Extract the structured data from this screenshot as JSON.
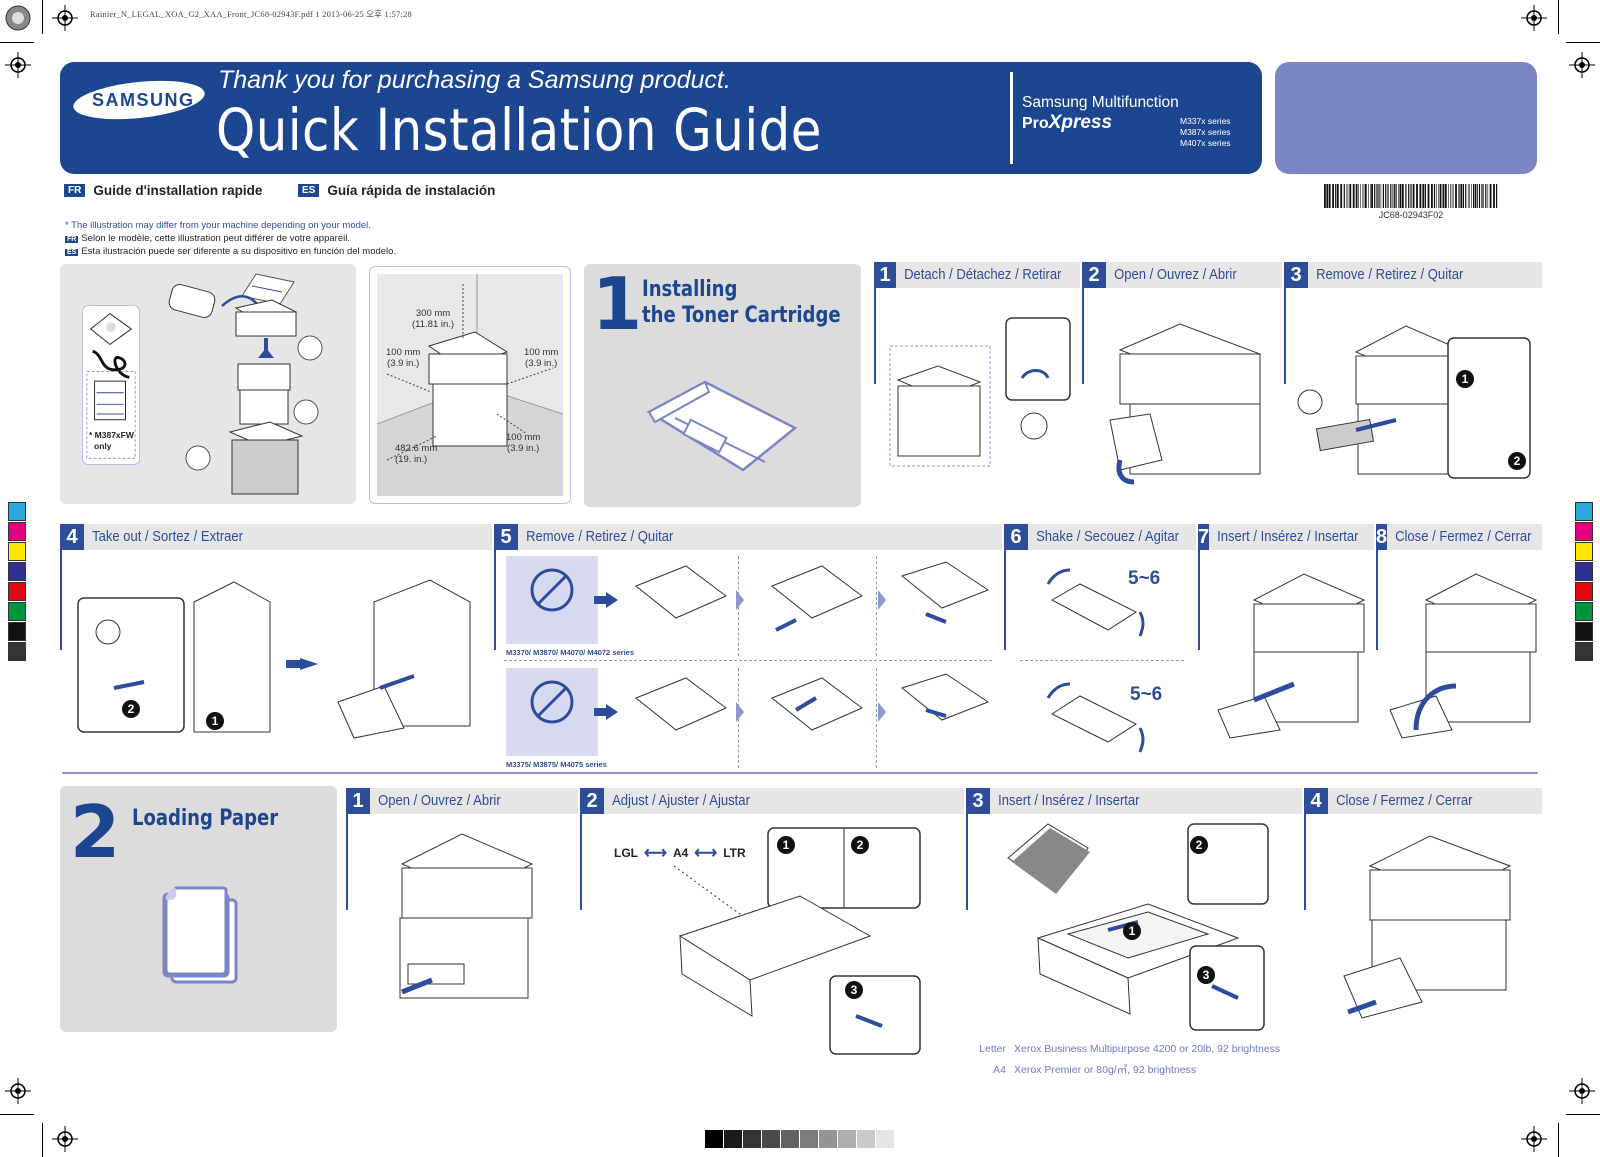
{
  "print_info": {
    "file_line": "Rainier_N_LEGAL_XOA_G2_XAA_Front_JC68-02943F.pdf   1   2013-06-25   오후 1:57:28"
  },
  "header": {
    "brand": "SAMSUNG",
    "tagline": "Thank you for purchasing a Samsung product.",
    "title": "Quick Installation Guide",
    "product_prefix": "Samsung Multifunction ",
    "product_name_pro": "Pro",
    "product_name_x": "Xpress",
    "series": [
      "M337x series",
      "M387x series",
      "M407x series"
    ],
    "colors": {
      "primary": "#1d4690",
      "secondary": "#7b86c4"
    }
  },
  "languages": [
    {
      "code": "FR",
      "title": "Guide d'installation rapide"
    },
    {
      "code": "ES",
      "title": "Guía rápida de instalación"
    }
  ],
  "barcode": {
    "label": "JC68-02943F02"
  },
  "notes": {
    "en": "* The illustration may differ from your machine depending on your model.",
    "fr_code": "FR",
    "fr": "Selon le modèle, cette illustration peut différer de votre appareil.",
    "es_code": "ES",
    "es": "Esta ilustración puede ser diferente a su dispositivo en función del modelo."
  },
  "unboxing": {
    "only_note_line1": "* M387xFW",
    "only_note_line2": "only"
  },
  "clearance": {
    "top": {
      "mm": "300 mm",
      "in": "(11.81 in.)"
    },
    "left": {
      "mm": "100 mm",
      "in": "(3.9 in.)"
    },
    "right": {
      "mm": "100 mm",
      "in": "(3.9 in.)"
    },
    "front": {
      "mm": "482.6 mm",
      "in": "(19. in.)"
    },
    "back": {
      "mm": "100 mm",
      "in": "(3.9 in.)"
    }
  },
  "section1": {
    "number": "1",
    "title_line1": "Installing",
    "title_line2": "the Toner Cartridge",
    "steps": [
      {
        "num": "1",
        "label": "Detach / Détachez / Retirar"
      },
      {
        "num": "2",
        "label": "Open / Ouvrez / Abrir"
      },
      {
        "num": "3",
        "label": "Remove / Retirez / Quitar"
      },
      {
        "num": "4",
        "label": "Take out /  Sortez / Extraer"
      },
      {
        "num": "5",
        "label": "Remove / Retirez / Quitar"
      },
      {
        "num": "6",
        "label": "Shake / Secouez / Agitar"
      },
      {
        "num": "7",
        "label": "Insert / Insérez / Insertar"
      },
      {
        "num": "8",
        "label": "Close / Fermez / Cerrar"
      }
    ],
    "series_a": "M3370/ M3870/ M4070/ M4072 series",
    "series_b": "M3375/ M3875/ M4075 series",
    "shake_count": "5~6",
    "callouts": {
      "one": "1",
      "two": "2"
    }
  },
  "section2": {
    "number": "2",
    "title": "Loading Paper",
    "steps": [
      {
        "num": "1",
        "label": "Open / Ouvrez / Abrir"
      },
      {
        "num": "2",
        "label": "Adjust / Ajuster / Ajustar"
      },
      {
        "num": "3",
        "label": "Insert / Insérez / Insertar"
      },
      {
        "num": "4",
        "label": "Close / Fermez / Cerrar"
      }
    ],
    "paper_sizes": {
      "lgl": "LGL",
      "a4": "A4",
      "ltr": "LTR"
    },
    "callouts": {
      "one": "1",
      "two": "2",
      "three": "3"
    },
    "paper_notes": [
      {
        "size": "Letter",
        "text": "Xerox Business Multipurpose 4200 or 20lb, 92 brightness"
      },
      {
        "size": "A4",
        "text": "Xerox Premier or 80g/㎡, 92 brightness"
      }
    ]
  },
  "color_bar": [
    "#29a8e0",
    "#e5007e",
    "#ffe600",
    "#2e3192",
    "#e30613",
    "#009640",
    "#111111",
    "#333333"
  ],
  "gray_strip": [
    "#000000",
    "#1b1b1b",
    "#333333",
    "#4a4a4a",
    "#626262",
    "#7b7b7b",
    "#959595",
    "#afafaf",
    "#c9c9c9",
    "#e4e4e4"
  ]
}
